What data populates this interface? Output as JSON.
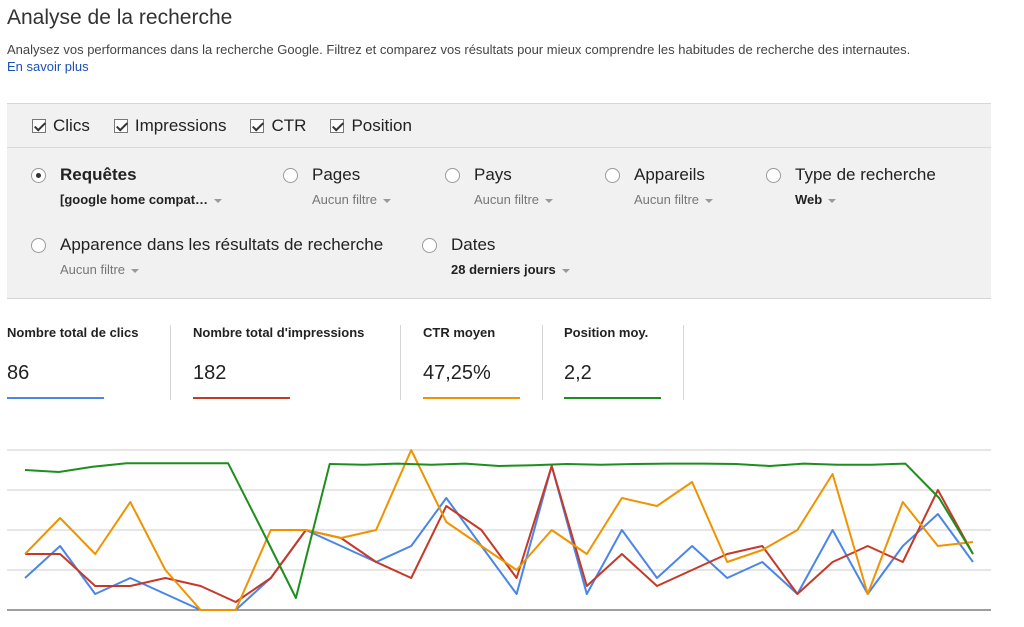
{
  "header": {
    "title": "Analyse de la recherche",
    "description": "Analysez vos performances dans la recherche Google. Filtrez et comparez vos résultats pour mieux comprendre les habitudes de recherche des internautes.",
    "learn_more": "En savoir plus"
  },
  "metrics": [
    {
      "label": "Clics",
      "checked": true
    },
    {
      "label": "Impressions",
      "checked": true
    },
    {
      "label": "CTR",
      "checked": true
    },
    {
      "label": "Position",
      "checked": true
    }
  ],
  "dimensions": [
    {
      "label": "Requêtes",
      "filter": "[google home compat…",
      "selected": true
    },
    {
      "label": "Pages",
      "filter": "Aucun filtre",
      "selected": false
    },
    {
      "label": "Pays",
      "filter": "Aucun filtre",
      "selected": false
    },
    {
      "label": "Appareils",
      "filter": "Aucun filtre",
      "selected": false
    },
    {
      "label": "Type de recherche",
      "filter": "Web",
      "selected": false
    },
    {
      "label": "Apparence dans les résultats de recherche",
      "filter": "Aucun filtre",
      "selected": false
    },
    {
      "label": "Dates",
      "filter": "28 derniers jours",
      "selected": false
    }
  ],
  "totals": [
    {
      "label": "Nombre total de clics",
      "value": "86",
      "color": "#4a86e8"
    },
    {
      "label": "Nombre total d'impressions",
      "value": "182",
      "color": "#c53929"
    },
    {
      "label": "CTR moyen",
      "value": "47,25%",
      "color": "#f09300"
    },
    {
      "label": "Position moy.",
      "value": "2,2",
      "color": "#1e8e1e"
    }
  ],
  "chart_data": {
    "type": "line",
    "title": "",
    "xlabel": "",
    "ylabel": "",
    "grid": true,
    "ylim": [
      0,
      4
    ],
    "x": [
      1,
      2,
      3,
      4,
      5,
      6,
      7,
      8,
      9,
      10,
      11,
      12,
      13,
      14,
      15,
      16,
      17,
      18,
      19,
      20,
      21,
      22,
      23,
      24,
      25,
      26,
      27,
      28,
      29
    ],
    "series": [
      {
        "color": "#4a86e8",
        "values": [
          0.8,
          1.6,
          0.4,
          0.8,
          0.4,
          0.0,
          0.0,
          0.8,
          2.0,
          1.6,
          1.2,
          1.6,
          2.8,
          1.6,
          0.4,
          3.6,
          0.4,
          2.0,
          0.8,
          1.6,
          0.8,
          1.2,
          0.4,
          2.0,
          0.4,
          1.6,
          2.4,
          1.2
        ]
      },
      {
        "color": "#c53929",
        "values": [
          1.4,
          1.4,
          0.6,
          0.6,
          0.8,
          0.6,
          0.2,
          0.8,
          2.0,
          1.8,
          1.2,
          0.8,
          2.6,
          2.0,
          0.8,
          3.6,
          0.6,
          1.4,
          0.6,
          1.0,
          1.4,
          1.6,
          0.4,
          1.2,
          1.6,
          1.2,
          3.0,
          1.4
        ]
      },
      {
        "color": "#f09300",
        "values": [
          1.4,
          2.3,
          1.4,
          2.7,
          1.0,
          0.0,
          0.0,
          2.0,
          2.0,
          1.8,
          2.0,
          4.0,
          2.2,
          1.6,
          1.0,
          2.0,
          1.4,
          2.8,
          2.6,
          3.2,
          1.2,
          1.5,
          2.0,
          3.4,
          0.4,
          2.7,
          1.6,
          1.7
        ]
      },
      {
        "color": "#1e8e1e",
        "values": [
          3.5,
          3.45,
          3.58,
          3.67,
          3.67,
          3.67,
          3.67,
          2.0,
          0.3,
          3.65,
          3.63,
          3.66,
          3.63,
          3.66,
          3.6,
          3.62,
          3.65,
          3.63,
          3.65,
          3.66,
          3.66,
          3.65,
          3.6,
          3.66,
          3.63,
          3.63,
          3.66,
          2.8,
          1.4
        ]
      }
    ]
  }
}
